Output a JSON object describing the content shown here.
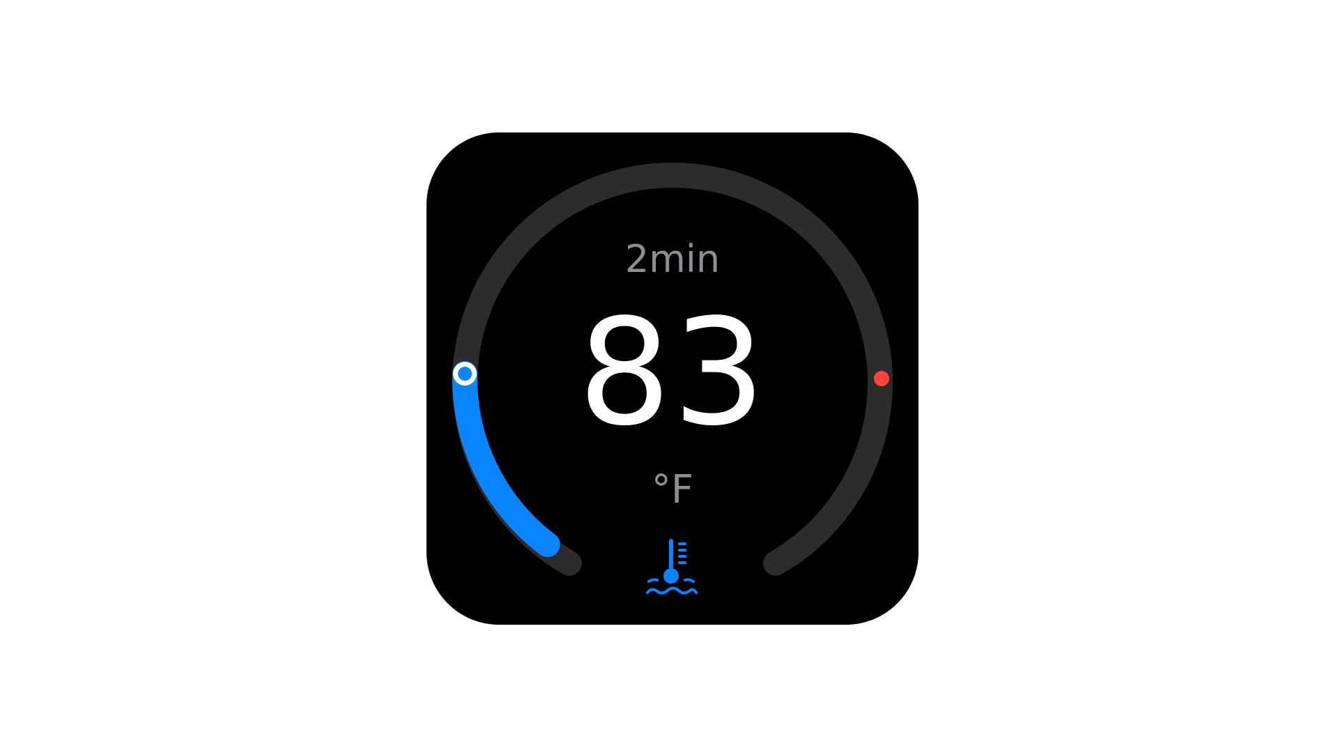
{
  "widget": {
    "duration": "2min",
    "temperature": "83",
    "unit": "°F",
    "icon": "water-thermometer-icon"
  },
  "gauge": {
    "level_fraction": 0.19,
    "min_marker_color": "#0a84ff",
    "max_marker_color": "#ff453a",
    "track_color": "#2c2c2e",
    "fill_color": "#0a84ff",
    "knob_color": "#0a84ff",
    "knob_ring_color": "#ffffff"
  }
}
